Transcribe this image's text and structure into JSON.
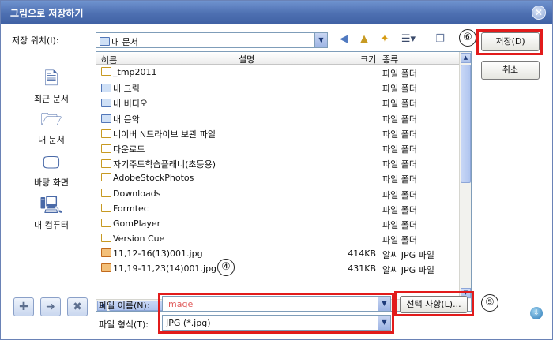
{
  "window": {
    "title": "그림으로 저장하기",
    "close_symbol": "✕"
  },
  "location": {
    "label": "저장 위치(I):",
    "value": "내 문서"
  },
  "toolbar": [
    {
      "name": "back-icon",
      "glyph": "◀",
      "color": "#4f79c0"
    },
    {
      "name": "up-folder-icon",
      "glyph": "▲",
      "color": "#c79a22"
    },
    {
      "name": "new-folder-icon",
      "glyph": "✦",
      "color": "#d69a10"
    },
    {
      "name": "view-menu-icon",
      "glyph": "☰▾",
      "color": "#3b4b6b"
    },
    {
      "name": "tools-icon",
      "glyph": "❐",
      "color": "#6b7da0"
    }
  ],
  "places": [
    {
      "label": "최근 문서",
      "icon": "recent-documents-icon",
      "glyph": "🗎"
    },
    {
      "label": "내 문서",
      "icon": "my-documents-icon",
      "glyph": "🗁"
    },
    {
      "label": "바탕 화면",
      "icon": "desktop-icon",
      "glyph": "🖵"
    },
    {
      "label": "내 컴퓨터",
      "icon": "my-computer-icon",
      "glyph": "🖳"
    }
  ],
  "columns": {
    "name": "이름",
    "sort_indicator": "▲",
    "description": "설명",
    "size": "크기",
    "type": "종류"
  },
  "files": [
    {
      "name": "_tmp2011",
      "size": "",
      "type": "파일 폴더",
      "icon": "folder"
    },
    {
      "name": "내 그림",
      "size": "",
      "type": "파일 폴더",
      "icon": "special"
    },
    {
      "name": "내 비디오",
      "size": "",
      "type": "파일 폴더",
      "icon": "special"
    },
    {
      "name": "내 음악",
      "size": "",
      "type": "파일 폴더",
      "icon": "special"
    },
    {
      "name": "네이버 N드라이브 보관 파일",
      "size": "",
      "type": "파일 폴더",
      "icon": "folder"
    },
    {
      "name": "다운로드",
      "size": "",
      "type": "파일 폴더",
      "icon": "folder"
    },
    {
      "name": "자기주도학습플래너(초등용)",
      "size": "",
      "type": "파일 폴더",
      "icon": "folder"
    },
    {
      "name": "AdobeStockPhotos",
      "size": "",
      "type": "파일 폴더",
      "icon": "folder"
    },
    {
      "name": "Downloads",
      "size": "",
      "type": "파일 폴더",
      "icon": "folder"
    },
    {
      "name": "Formtec",
      "size": "",
      "type": "파일 폴더",
      "icon": "folder"
    },
    {
      "name": "GomPlayer",
      "size": "",
      "type": "파일 폴더",
      "icon": "folder"
    },
    {
      "name": "Version Cue",
      "size": "",
      "type": "파일 폴더",
      "icon": "folder"
    },
    {
      "name": "11,12-16(13)001.jpg",
      "size": "414KB",
      "type": "알씨 JPG 파일",
      "icon": "jpg"
    },
    {
      "name": "11,19-11,23(14)001.jpg",
      "size": "431KB",
      "type": "알씨 JPG 파일",
      "icon": "jpg"
    }
  ],
  "filename": {
    "label": "파일 이름(N):",
    "value": "image"
  },
  "filetype": {
    "label": "파일 형식(T):",
    "value": "JPG (*.jpg)"
  },
  "buttons": {
    "save": "저장(D)",
    "cancel": "취소",
    "options": "선택 사항(L)..."
  },
  "annotations": {
    "four": "④",
    "five": "⑤",
    "six": "⑥"
  },
  "colors": {
    "title_bar": "#4d6fb1",
    "highlight_box": "#e21b1b",
    "filename_text": "#e05a5a"
  }
}
